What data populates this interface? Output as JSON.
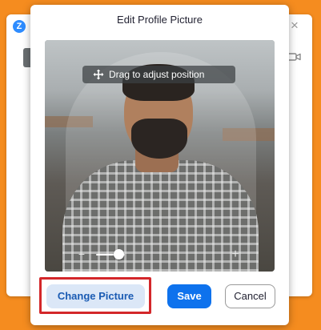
{
  "app": {
    "logo_letter": "Z"
  },
  "dialog": {
    "title": "Edit Profile Picture",
    "drag_hint": "Drag to adjust position",
    "zoom": {
      "minus_label": "−",
      "plus_label": "+",
      "level": 0.9
    },
    "buttons": {
      "change_picture": "Change Picture",
      "save": "Save",
      "cancel": "Cancel"
    }
  },
  "colors": {
    "background": "#f58c1f",
    "primary": "#0e72ed",
    "highlight": "#d3272a"
  }
}
